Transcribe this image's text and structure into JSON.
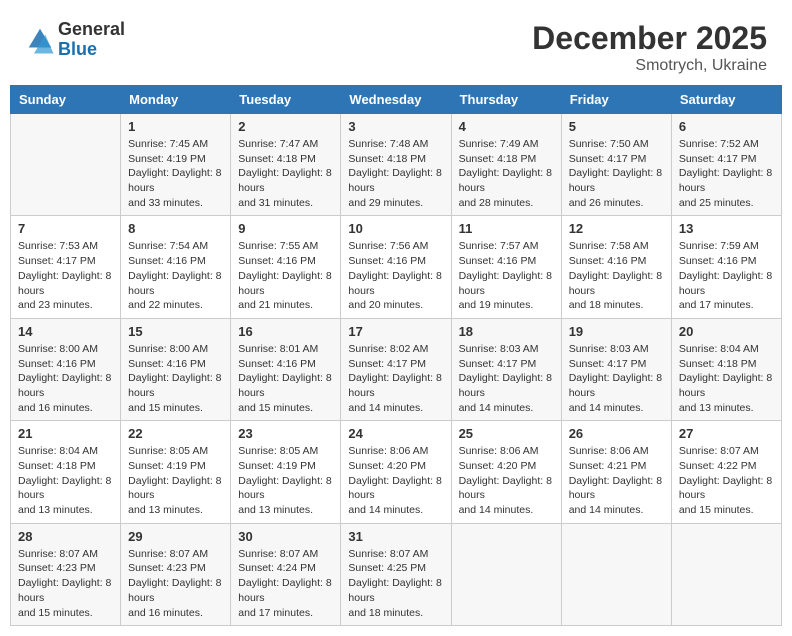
{
  "header": {
    "logo_general": "General",
    "logo_blue": "Blue",
    "month_title": "December 2025",
    "location": "Smotrych, Ukraine"
  },
  "days_of_week": [
    "Sunday",
    "Monday",
    "Tuesday",
    "Wednesday",
    "Thursday",
    "Friday",
    "Saturday"
  ],
  "weeks": [
    [
      {
        "day": "",
        "sunrise": "",
        "sunset": "",
        "daylight": ""
      },
      {
        "day": "1",
        "sunrise": "Sunrise: 7:45 AM",
        "sunset": "Sunset: 4:19 PM",
        "daylight": "Daylight: 8 hours and 33 minutes."
      },
      {
        "day": "2",
        "sunrise": "Sunrise: 7:47 AM",
        "sunset": "Sunset: 4:18 PM",
        "daylight": "Daylight: 8 hours and 31 minutes."
      },
      {
        "day": "3",
        "sunrise": "Sunrise: 7:48 AM",
        "sunset": "Sunset: 4:18 PM",
        "daylight": "Daylight: 8 hours and 29 minutes."
      },
      {
        "day": "4",
        "sunrise": "Sunrise: 7:49 AM",
        "sunset": "Sunset: 4:18 PM",
        "daylight": "Daylight: 8 hours and 28 minutes."
      },
      {
        "day": "5",
        "sunrise": "Sunrise: 7:50 AM",
        "sunset": "Sunset: 4:17 PM",
        "daylight": "Daylight: 8 hours and 26 minutes."
      },
      {
        "day": "6",
        "sunrise": "Sunrise: 7:52 AM",
        "sunset": "Sunset: 4:17 PM",
        "daylight": "Daylight: 8 hours and 25 minutes."
      }
    ],
    [
      {
        "day": "7",
        "sunrise": "Sunrise: 7:53 AM",
        "sunset": "Sunset: 4:17 PM",
        "daylight": "Daylight: 8 hours and 23 minutes."
      },
      {
        "day": "8",
        "sunrise": "Sunrise: 7:54 AM",
        "sunset": "Sunset: 4:16 PM",
        "daylight": "Daylight: 8 hours and 22 minutes."
      },
      {
        "day": "9",
        "sunrise": "Sunrise: 7:55 AM",
        "sunset": "Sunset: 4:16 PM",
        "daylight": "Daylight: 8 hours and 21 minutes."
      },
      {
        "day": "10",
        "sunrise": "Sunrise: 7:56 AM",
        "sunset": "Sunset: 4:16 PM",
        "daylight": "Daylight: 8 hours and 20 minutes."
      },
      {
        "day": "11",
        "sunrise": "Sunrise: 7:57 AM",
        "sunset": "Sunset: 4:16 PM",
        "daylight": "Daylight: 8 hours and 19 minutes."
      },
      {
        "day": "12",
        "sunrise": "Sunrise: 7:58 AM",
        "sunset": "Sunset: 4:16 PM",
        "daylight": "Daylight: 8 hours and 18 minutes."
      },
      {
        "day": "13",
        "sunrise": "Sunrise: 7:59 AM",
        "sunset": "Sunset: 4:16 PM",
        "daylight": "Daylight: 8 hours and 17 minutes."
      }
    ],
    [
      {
        "day": "14",
        "sunrise": "Sunrise: 8:00 AM",
        "sunset": "Sunset: 4:16 PM",
        "daylight": "Daylight: 8 hours and 16 minutes."
      },
      {
        "day": "15",
        "sunrise": "Sunrise: 8:00 AM",
        "sunset": "Sunset: 4:16 PM",
        "daylight": "Daylight: 8 hours and 15 minutes."
      },
      {
        "day": "16",
        "sunrise": "Sunrise: 8:01 AM",
        "sunset": "Sunset: 4:16 PM",
        "daylight": "Daylight: 8 hours and 15 minutes."
      },
      {
        "day": "17",
        "sunrise": "Sunrise: 8:02 AM",
        "sunset": "Sunset: 4:17 PM",
        "daylight": "Daylight: 8 hours and 14 minutes."
      },
      {
        "day": "18",
        "sunrise": "Sunrise: 8:03 AM",
        "sunset": "Sunset: 4:17 PM",
        "daylight": "Daylight: 8 hours and 14 minutes."
      },
      {
        "day": "19",
        "sunrise": "Sunrise: 8:03 AM",
        "sunset": "Sunset: 4:17 PM",
        "daylight": "Daylight: 8 hours and 14 minutes."
      },
      {
        "day": "20",
        "sunrise": "Sunrise: 8:04 AM",
        "sunset": "Sunset: 4:18 PM",
        "daylight": "Daylight: 8 hours and 13 minutes."
      }
    ],
    [
      {
        "day": "21",
        "sunrise": "Sunrise: 8:04 AM",
        "sunset": "Sunset: 4:18 PM",
        "daylight": "Daylight: 8 hours and 13 minutes."
      },
      {
        "day": "22",
        "sunrise": "Sunrise: 8:05 AM",
        "sunset": "Sunset: 4:19 PM",
        "daylight": "Daylight: 8 hours and 13 minutes."
      },
      {
        "day": "23",
        "sunrise": "Sunrise: 8:05 AM",
        "sunset": "Sunset: 4:19 PM",
        "daylight": "Daylight: 8 hours and 13 minutes."
      },
      {
        "day": "24",
        "sunrise": "Sunrise: 8:06 AM",
        "sunset": "Sunset: 4:20 PM",
        "daylight": "Daylight: 8 hours and 14 minutes."
      },
      {
        "day": "25",
        "sunrise": "Sunrise: 8:06 AM",
        "sunset": "Sunset: 4:20 PM",
        "daylight": "Daylight: 8 hours and 14 minutes."
      },
      {
        "day": "26",
        "sunrise": "Sunrise: 8:06 AM",
        "sunset": "Sunset: 4:21 PM",
        "daylight": "Daylight: 8 hours and 14 minutes."
      },
      {
        "day": "27",
        "sunrise": "Sunrise: 8:07 AM",
        "sunset": "Sunset: 4:22 PM",
        "daylight": "Daylight: 8 hours and 15 minutes."
      }
    ],
    [
      {
        "day": "28",
        "sunrise": "Sunrise: 8:07 AM",
        "sunset": "Sunset: 4:23 PM",
        "daylight": "Daylight: 8 hours and 15 minutes."
      },
      {
        "day": "29",
        "sunrise": "Sunrise: 8:07 AM",
        "sunset": "Sunset: 4:23 PM",
        "daylight": "Daylight: 8 hours and 16 minutes."
      },
      {
        "day": "30",
        "sunrise": "Sunrise: 8:07 AM",
        "sunset": "Sunset: 4:24 PM",
        "daylight": "Daylight: 8 hours and 17 minutes."
      },
      {
        "day": "31",
        "sunrise": "Sunrise: 8:07 AM",
        "sunset": "Sunset: 4:25 PM",
        "daylight": "Daylight: 8 hours and 18 minutes."
      },
      {
        "day": "",
        "sunrise": "",
        "sunset": "",
        "daylight": ""
      },
      {
        "day": "",
        "sunrise": "",
        "sunset": "",
        "daylight": ""
      },
      {
        "day": "",
        "sunrise": "",
        "sunset": "",
        "daylight": ""
      }
    ]
  ]
}
